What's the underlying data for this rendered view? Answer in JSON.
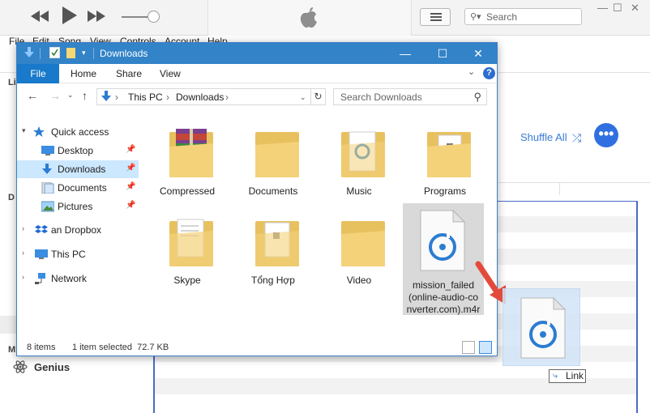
{
  "itunes": {
    "search_placeholder": "Search",
    "menu": [
      "File",
      "Edit",
      "Song",
      "View",
      "Controls",
      "Account",
      "Help"
    ],
    "shuffle_label": "Shuffle All",
    "genius_label": "Genius",
    "side_letters": [
      "Li",
      "D",
      "M"
    ],
    "accent_color": "#3a7bd5"
  },
  "explorer": {
    "title": "Downloads",
    "ribbon_tabs": [
      "File",
      "Home",
      "Share",
      "View"
    ],
    "address": [
      "This PC",
      "Downloads"
    ],
    "search_placeholder": "Search Downloads",
    "nav": {
      "quick_access": "Quick access",
      "items": [
        {
          "label": "Desktop",
          "icon": "desktop-icon",
          "pinned": true
        },
        {
          "label": "Downloads",
          "icon": "downloads-icon",
          "pinned": true,
          "selected": true
        },
        {
          "label": "Documents",
          "icon": "documents-icon",
          "pinned": true
        },
        {
          "label": "Pictures",
          "icon": "pictures-icon",
          "pinned": true
        }
      ],
      "dropbox": "an Dropbox",
      "this_pc": "This PC",
      "network": "Network"
    },
    "files": [
      {
        "name": "Compressed",
        "type": "folder"
      },
      {
        "name": "Documents",
        "type": "folder"
      },
      {
        "name": "Music",
        "type": "folder"
      },
      {
        "name": "Programs",
        "type": "folder"
      },
      {
        "name": "Skype",
        "type": "folder"
      },
      {
        "name": "Tổng Hợp",
        "type": "folder"
      },
      {
        "name": "Video",
        "type": "folder"
      },
      {
        "name": "mission_failed (online-audio-converter.com).m4r",
        "name_lines": [
          "mission_failed",
          "(online-audio-co",
          "nverter.com).m4r"
        ],
        "type": "audio",
        "selected": true
      }
    ],
    "status": {
      "items": "8 items",
      "selected": "1 item selected  72.7 KB"
    }
  },
  "drag": {
    "tooltip": "Link",
    "arrow_color": "#e24b3b"
  }
}
